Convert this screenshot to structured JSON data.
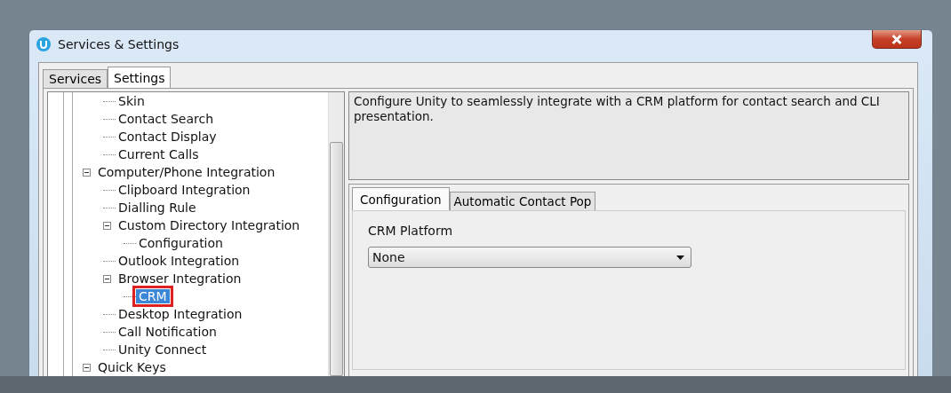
{
  "window": {
    "title": "Services & Settings"
  },
  "tabs": [
    {
      "label": "Services",
      "selected": false
    },
    {
      "label": "Settings",
      "selected": true
    }
  ],
  "tree": {
    "items": [
      {
        "children": [
          {
            "label": "Skin",
            "selected": false
          },
          {
            "label": "Contact Search",
            "selected": false
          },
          {
            "label": "Contact Display",
            "selected": false
          },
          {
            "label": "Current Calls",
            "selected": false
          }
        ]
      },
      {
        "label": "Computer/Phone Integration",
        "selected": false,
        "expanded": true,
        "children": [
          {
            "label": "Clipboard Integration",
            "selected": false
          },
          {
            "label": "Dialling Rule",
            "selected": false
          },
          {
            "label": "Custom Directory Integration",
            "selected": false,
            "expanded": true,
            "children": [
              {
                "label": "Configuration",
                "selected": false
              }
            ]
          },
          {
            "label": "Outlook Integration",
            "selected": false
          },
          {
            "label": "Browser Integration",
            "selected": false,
            "expanded": true,
            "children": [
              {
                "label": "CRM",
                "selected": true
              }
            ]
          },
          {
            "label": "Desktop Integration",
            "selected": false
          },
          {
            "label": "Call Notification",
            "selected": false
          },
          {
            "label": "Unity Connect",
            "selected": false
          }
        ]
      },
      {
        "label": "Quick Keys",
        "selected": false,
        "expanded": true
      }
    ]
  },
  "description": "Configure Unity to seamlessly integrate with a CRM platform for contact search and CLI presentation.",
  "detail_tabs": [
    {
      "label": "Configuration",
      "selected": true
    },
    {
      "label": "Automatic Contact Pop",
      "selected": false
    }
  ],
  "crm_platform": {
    "label": "CRM Platform",
    "value": "None"
  }
}
